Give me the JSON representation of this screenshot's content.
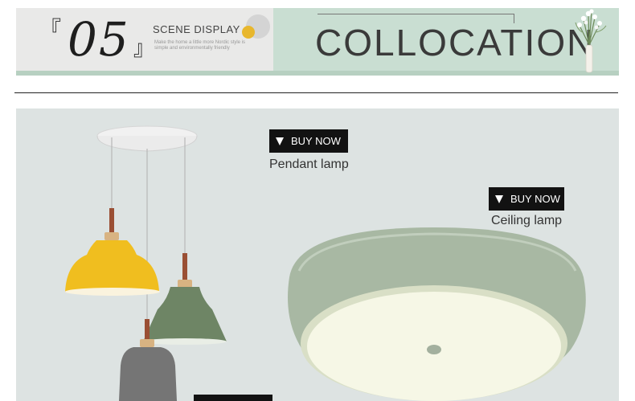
{
  "banner": {
    "bracket_open": "『",
    "number": "05",
    "bracket_close": "』",
    "scene_title": "SCENE DISPLAY",
    "scene_subtitle": "Make the home a little more Nordic style is simple and environmentally friendly",
    "heading": "COLLOCATION",
    "colors": {
      "left_bg": "#e9e9e8",
      "right_bg": "#c9ded2",
      "accent_yellow": "#e8b72d"
    }
  },
  "products": [
    {
      "button_label": "BUY NOW",
      "name": "Pendant lamp",
      "button_icon": "triangle-down-icon"
    },
    {
      "button_label": "BUY NOW",
      "name": "Ceiling lamp",
      "button_icon": "triangle-down-icon"
    }
  ],
  "colors": {
    "button_bg": "#121212",
    "photo_bg": "#dde3e2",
    "lamp_yellow": "#f0be1f",
    "lamp_green": "#6e8565",
    "lamp_grey": "#757575",
    "ceiling_green": "#a8b8a3"
  }
}
